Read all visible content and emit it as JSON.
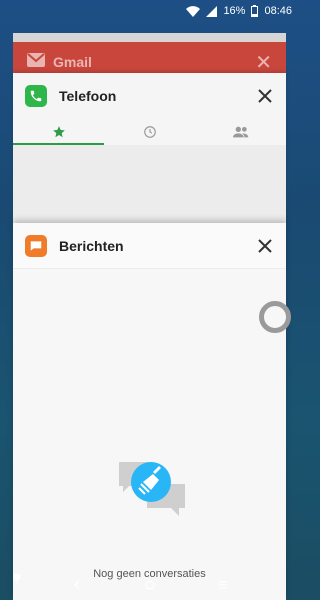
{
  "status": {
    "battery": "16%",
    "time": "08:46"
  },
  "recents": {
    "gmail": {
      "title": "Gmail"
    },
    "phone": {
      "title": "Telefoon",
      "tabs": [
        "favorites-star-icon",
        "recents-clock-icon",
        "contacts-people-icon"
      ]
    },
    "messages": {
      "title": "Berichten",
      "empty_text": "Nog geen conversaties"
    }
  },
  "colors": {
    "phone_icon": "#2fb64a",
    "messages_icon": "#f07b2b",
    "gmail_card": "#c9463d",
    "fab": "#29b6f6",
    "tab_active": "#2e9b46"
  }
}
